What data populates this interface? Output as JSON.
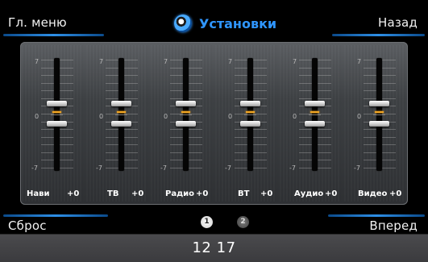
{
  "header": {
    "main_menu_label": "Гл. меню",
    "title": "Установки",
    "back_label": "Назад"
  },
  "footer": {
    "reset_label": "Сброс",
    "forward_label": "Вперед",
    "pages": [
      "1",
      "2"
    ],
    "active_page": 1
  },
  "mixer": {
    "scale_max": "7",
    "scale_zero": "0",
    "scale_min": "-7",
    "channels": [
      {
        "label": "Нави",
        "value": "+0",
        "level": 0
      },
      {
        "label": "ТВ",
        "value": "+0",
        "level": 0
      },
      {
        "label": "Радио",
        "value": "+0",
        "level": 0
      },
      {
        "label": "BT",
        "value": "+0",
        "level": 0
      },
      {
        "label": "Аудио",
        "value": "+0",
        "level": 0
      },
      {
        "label": "Видео",
        "value": "+0",
        "level": 0
      }
    ]
  },
  "status": {
    "time": "12 17"
  },
  "colors": {
    "accent": "#2f96ff",
    "slider_indicator": "#f2a623",
    "background": "#000000"
  }
}
